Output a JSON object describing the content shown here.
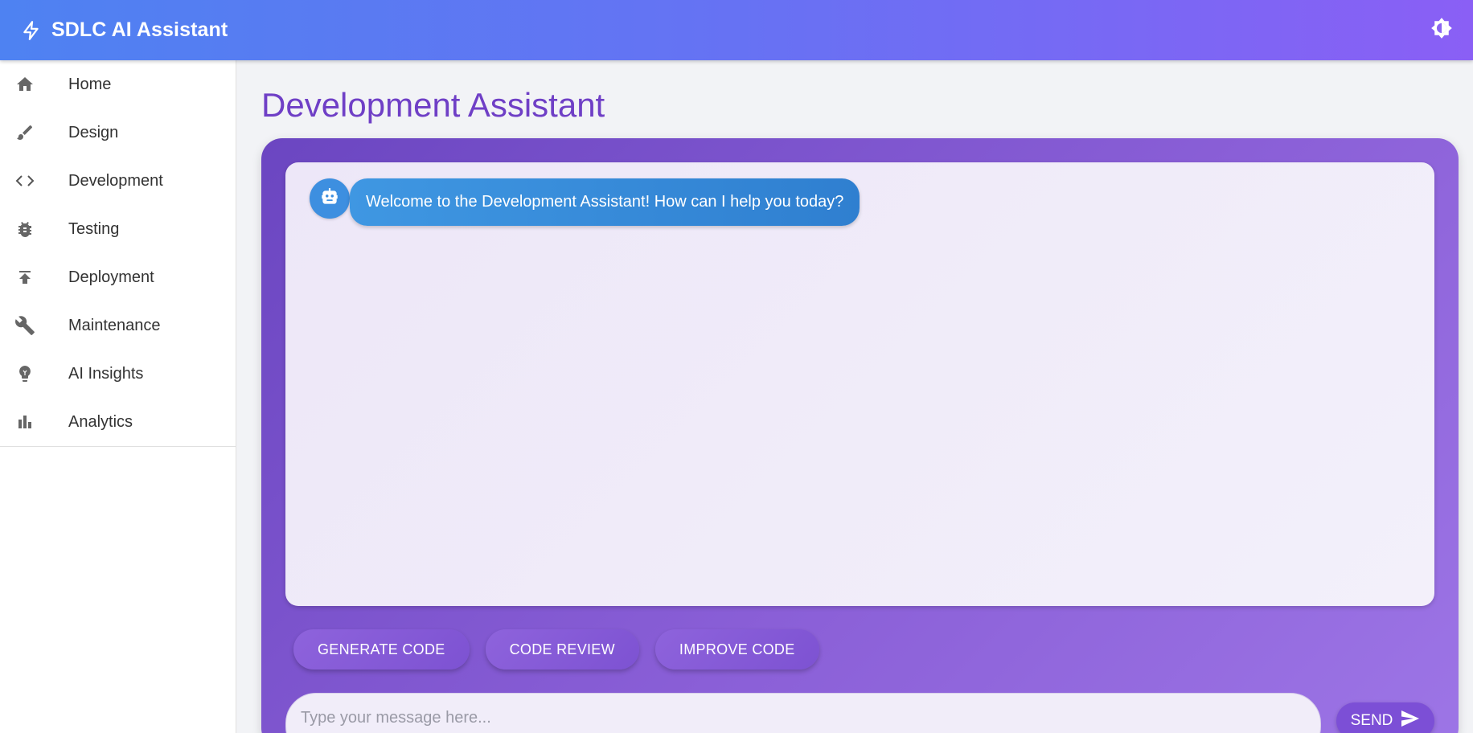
{
  "appbar": {
    "title": "SDLC AI Assistant",
    "logo_icon": "bolt-icon",
    "theme_toggle_icon": "brightness-icon"
  },
  "sidebar": {
    "items": [
      {
        "label": "Home",
        "icon": "home-icon"
      },
      {
        "label": "Design",
        "icon": "brush-icon"
      },
      {
        "label": "Development",
        "icon": "code-icon"
      },
      {
        "label": "Testing",
        "icon": "bug-icon"
      },
      {
        "label": "Deployment",
        "icon": "upload-icon"
      },
      {
        "label": "Maintenance",
        "icon": "wrench-icon"
      },
      {
        "label": "AI Insights",
        "icon": "lightbulb-icon"
      },
      {
        "label": "Analytics",
        "icon": "bar-chart-icon"
      }
    ]
  },
  "main": {
    "title": "Development Assistant",
    "chat": {
      "messages": [
        {
          "sender": "bot",
          "avatar_icon": "robot-icon",
          "text": "Welcome to the Development Assistant! How can I help you today?"
        }
      ]
    },
    "actions": [
      "GENERATE CODE",
      "CODE REVIEW",
      "IMPROVE CODE"
    ],
    "input": {
      "placeholder": "Type your message here...",
      "value": ""
    },
    "send": {
      "label": "SEND",
      "icon": "send-icon"
    }
  },
  "colors": {
    "appbar_gradient_start": "#4e82f2",
    "appbar_gradient_end": "#8a5ff5",
    "title": "#6f3fc6",
    "panel": "#7d52d2",
    "bot_bubble": "#3a8fdc"
  }
}
